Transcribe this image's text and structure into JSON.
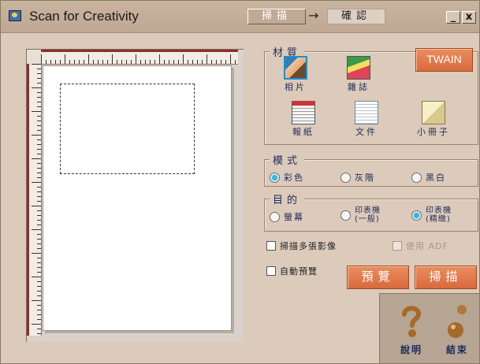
{
  "window": {
    "title": "Scan for Creativity",
    "step_current": "掃描",
    "step_arrow": "→",
    "step_next": "確認",
    "minimize": "_",
    "close": "x"
  },
  "material": {
    "label": "材質",
    "twain": "TWAIN",
    "items": [
      {
        "label": "相片",
        "icon": "photo-icon"
      },
      {
        "label": "雜誌",
        "icon": "magazine-icon"
      },
      {
        "label": "報紙",
        "icon": "newspaper-icon"
      },
      {
        "label": "文件",
        "icon": "document-icon"
      },
      {
        "label": "小冊子",
        "icon": "booklet-icon"
      }
    ],
    "selected": "相片"
  },
  "mode": {
    "label": "模式",
    "options": [
      "彩色",
      "灰階",
      "黑白"
    ],
    "selected": "彩色"
  },
  "purpose": {
    "label": "目的",
    "options": [
      {
        "line1": "螢幕",
        "line2": ""
      },
      {
        "line1": "印表機",
        "line2": "(一般)"
      },
      {
        "line1": "印表機",
        "line2": "(精緻)"
      }
    ],
    "selected": "印表機(精緻)"
  },
  "options": {
    "multi_scan": "掃描多張影像",
    "use_adf": "使用 ADF",
    "auto_preview": "自動預覽"
  },
  "actions": {
    "preview": "預覽",
    "scan": "掃描",
    "help": "說明",
    "exit": "結束"
  },
  "colors": {
    "background": "#dccaba",
    "accent_button": "#e07a4a",
    "label_text": "#1e2c5a"
  }
}
